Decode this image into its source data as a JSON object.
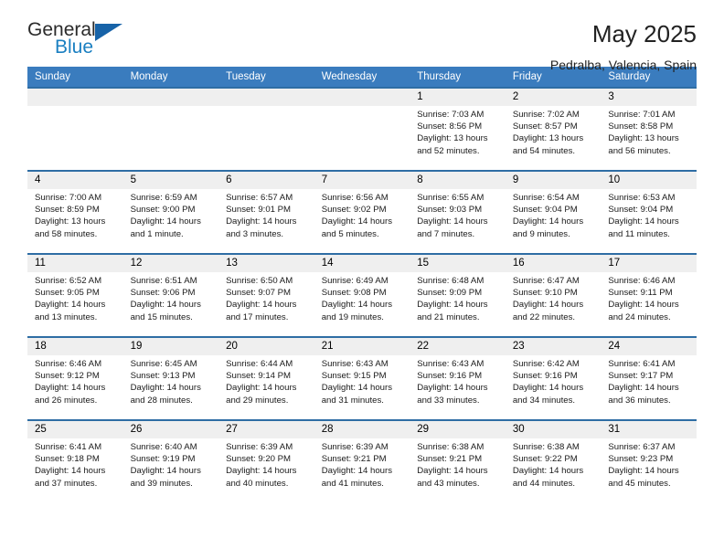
{
  "logo": {
    "word_one": "General",
    "word_two": "Blue",
    "triangle_color": "#1763a8"
  },
  "header": {
    "title": "May 2025",
    "subtitle": "Pedralba, Valencia, Spain"
  },
  "theme": {
    "header_bar": "#3a7cbe",
    "row_divider": "#2e6da4",
    "daynum_band": "#efefef"
  },
  "weekdays": [
    "Sunday",
    "Monday",
    "Tuesday",
    "Wednesday",
    "Thursday",
    "Friday",
    "Saturday"
  ],
  "weeks": [
    [
      {
        "day": "",
        "sunrise": "",
        "sunset": "",
        "daylight_line1": "",
        "daylight_line2": ""
      },
      {
        "day": "",
        "sunrise": "",
        "sunset": "",
        "daylight_line1": "",
        "daylight_line2": ""
      },
      {
        "day": "",
        "sunrise": "",
        "sunset": "",
        "daylight_line1": "",
        "daylight_line2": ""
      },
      {
        "day": "",
        "sunrise": "",
        "sunset": "",
        "daylight_line1": "",
        "daylight_line2": ""
      },
      {
        "day": "1",
        "sunrise": "Sunrise: 7:03 AM",
        "sunset": "Sunset: 8:56 PM",
        "daylight_line1": "Daylight: 13 hours",
        "daylight_line2": "and 52 minutes."
      },
      {
        "day": "2",
        "sunrise": "Sunrise: 7:02 AM",
        "sunset": "Sunset: 8:57 PM",
        "daylight_line1": "Daylight: 13 hours",
        "daylight_line2": "and 54 minutes."
      },
      {
        "day": "3",
        "sunrise": "Sunrise: 7:01 AM",
        "sunset": "Sunset: 8:58 PM",
        "daylight_line1": "Daylight: 13 hours",
        "daylight_line2": "and 56 minutes."
      }
    ],
    [
      {
        "day": "4",
        "sunrise": "Sunrise: 7:00 AM",
        "sunset": "Sunset: 8:59 PM",
        "daylight_line1": "Daylight: 13 hours",
        "daylight_line2": "and 58 minutes."
      },
      {
        "day": "5",
        "sunrise": "Sunrise: 6:59 AM",
        "sunset": "Sunset: 9:00 PM",
        "daylight_line1": "Daylight: 14 hours",
        "daylight_line2": "and 1 minute."
      },
      {
        "day": "6",
        "sunrise": "Sunrise: 6:57 AM",
        "sunset": "Sunset: 9:01 PM",
        "daylight_line1": "Daylight: 14 hours",
        "daylight_line2": "and 3 minutes."
      },
      {
        "day": "7",
        "sunrise": "Sunrise: 6:56 AM",
        "sunset": "Sunset: 9:02 PM",
        "daylight_line1": "Daylight: 14 hours",
        "daylight_line2": "and 5 minutes."
      },
      {
        "day": "8",
        "sunrise": "Sunrise: 6:55 AM",
        "sunset": "Sunset: 9:03 PM",
        "daylight_line1": "Daylight: 14 hours",
        "daylight_line2": "and 7 minutes."
      },
      {
        "day": "9",
        "sunrise": "Sunrise: 6:54 AM",
        "sunset": "Sunset: 9:04 PM",
        "daylight_line1": "Daylight: 14 hours",
        "daylight_line2": "and 9 minutes."
      },
      {
        "day": "10",
        "sunrise": "Sunrise: 6:53 AM",
        "sunset": "Sunset: 9:04 PM",
        "daylight_line1": "Daylight: 14 hours",
        "daylight_line2": "and 11 minutes."
      }
    ],
    [
      {
        "day": "11",
        "sunrise": "Sunrise: 6:52 AM",
        "sunset": "Sunset: 9:05 PM",
        "daylight_line1": "Daylight: 14 hours",
        "daylight_line2": "and 13 minutes."
      },
      {
        "day": "12",
        "sunrise": "Sunrise: 6:51 AM",
        "sunset": "Sunset: 9:06 PM",
        "daylight_line1": "Daylight: 14 hours",
        "daylight_line2": "and 15 minutes."
      },
      {
        "day": "13",
        "sunrise": "Sunrise: 6:50 AM",
        "sunset": "Sunset: 9:07 PM",
        "daylight_line1": "Daylight: 14 hours",
        "daylight_line2": "and 17 minutes."
      },
      {
        "day": "14",
        "sunrise": "Sunrise: 6:49 AM",
        "sunset": "Sunset: 9:08 PM",
        "daylight_line1": "Daylight: 14 hours",
        "daylight_line2": "and 19 minutes."
      },
      {
        "day": "15",
        "sunrise": "Sunrise: 6:48 AM",
        "sunset": "Sunset: 9:09 PM",
        "daylight_line1": "Daylight: 14 hours",
        "daylight_line2": "and 21 minutes."
      },
      {
        "day": "16",
        "sunrise": "Sunrise: 6:47 AM",
        "sunset": "Sunset: 9:10 PM",
        "daylight_line1": "Daylight: 14 hours",
        "daylight_line2": "and 22 minutes."
      },
      {
        "day": "17",
        "sunrise": "Sunrise: 6:46 AM",
        "sunset": "Sunset: 9:11 PM",
        "daylight_line1": "Daylight: 14 hours",
        "daylight_line2": "and 24 minutes."
      }
    ],
    [
      {
        "day": "18",
        "sunrise": "Sunrise: 6:46 AM",
        "sunset": "Sunset: 9:12 PM",
        "daylight_line1": "Daylight: 14 hours",
        "daylight_line2": "and 26 minutes."
      },
      {
        "day": "19",
        "sunrise": "Sunrise: 6:45 AM",
        "sunset": "Sunset: 9:13 PM",
        "daylight_line1": "Daylight: 14 hours",
        "daylight_line2": "and 28 minutes."
      },
      {
        "day": "20",
        "sunrise": "Sunrise: 6:44 AM",
        "sunset": "Sunset: 9:14 PM",
        "daylight_line1": "Daylight: 14 hours",
        "daylight_line2": "and 29 minutes."
      },
      {
        "day": "21",
        "sunrise": "Sunrise: 6:43 AM",
        "sunset": "Sunset: 9:15 PM",
        "daylight_line1": "Daylight: 14 hours",
        "daylight_line2": "and 31 minutes."
      },
      {
        "day": "22",
        "sunrise": "Sunrise: 6:43 AM",
        "sunset": "Sunset: 9:16 PM",
        "daylight_line1": "Daylight: 14 hours",
        "daylight_line2": "and 33 minutes."
      },
      {
        "day": "23",
        "sunrise": "Sunrise: 6:42 AM",
        "sunset": "Sunset: 9:16 PM",
        "daylight_line1": "Daylight: 14 hours",
        "daylight_line2": "and 34 minutes."
      },
      {
        "day": "24",
        "sunrise": "Sunrise: 6:41 AM",
        "sunset": "Sunset: 9:17 PM",
        "daylight_line1": "Daylight: 14 hours",
        "daylight_line2": "and 36 minutes."
      }
    ],
    [
      {
        "day": "25",
        "sunrise": "Sunrise: 6:41 AM",
        "sunset": "Sunset: 9:18 PM",
        "daylight_line1": "Daylight: 14 hours",
        "daylight_line2": "and 37 minutes."
      },
      {
        "day": "26",
        "sunrise": "Sunrise: 6:40 AM",
        "sunset": "Sunset: 9:19 PM",
        "daylight_line1": "Daylight: 14 hours",
        "daylight_line2": "and 39 minutes."
      },
      {
        "day": "27",
        "sunrise": "Sunrise: 6:39 AM",
        "sunset": "Sunset: 9:20 PM",
        "daylight_line1": "Daylight: 14 hours",
        "daylight_line2": "and 40 minutes."
      },
      {
        "day": "28",
        "sunrise": "Sunrise: 6:39 AM",
        "sunset": "Sunset: 9:21 PM",
        "daylight_line1": "Daylight: 14 hours",
        "daylight_line2": "and 41 minutes."
      },
      {
        "day": "29",
        "sunrise": "Sunrise: 6:38 AM",
        "sunset": "Sunset: 9:21 PM",
        "daylight_line1": "Daylight: 14 hours",
        "daylight_line2": "and 43 minutes."
      },
      {
        "day": "30",
        "sunrise": "Sunrise: 6:38 AM",
        "sunset": "Sunset: 9:22 PM",
        "daylight_line1": "Daylight: 14 hours",
        "daylight_line2": "and 44 minutes."
      },
      {
        "day": "31",
        "sunrise": "Sunrise: 6:37 AM",
        "sunset": "Sunset: 9:23 PM",
        "daylight_line1": "Daylight: 14 hours",
        "daylight_line2": "and 45 minutes."
      }
    ]
  ]
}
